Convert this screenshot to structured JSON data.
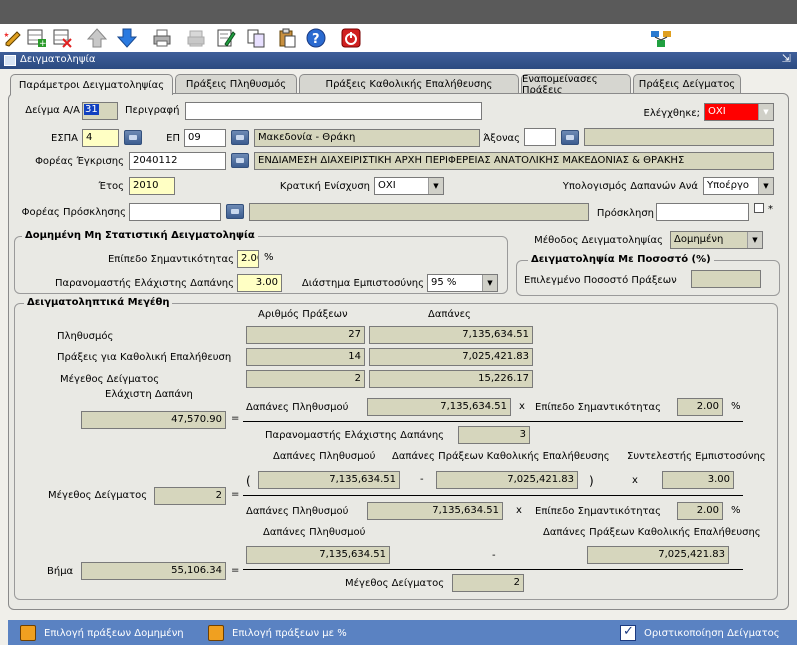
{
  "window": {
    "title": "Δειγματοληψία"
  },
  "toolbar": {
    "icons": [
      "pencil-star-icon",
      "add-row-icon",
      "delete-row-icon",
      "arrow-up-icon",
      "arrow-down-icon",
      "print-icon",
      "print-disabled-icon",
      "edit-doc-icon",
      "copy-icon",
      "paste-icon",
      "help-icon",
      "exit-icon",
      "hierarchy-icon"
    ]
  },
  "tabs": [
    "Παράμετροι Δειγματοληψίας",
    "Πράξεις Πληθυσμός",
    "Πράξεις Καθολικής Επαλήθευσης",
    "Εναπομείνασες Πράξεις",
    "Πράξεις Δείγματος"
  ],
  "form": {
    "sample_label": "Δείγμα Α/Α",
    "sample_value": "31",
    "description_label": "Περιγραφή",
    "description_value": "",
    "checked_label": "Ελέγχθηκε;",
    "checked_value": "ΟΧΙ",
    "espa_label": "ΕΣΠΑ",
    "espa_value": "4",
    "ep_label": "ΕΠ",
    "ep_value": "09",
    "ep_name": "Μακεδονία - Θράκη",
    "axis_label": "Άξονας",
    "axis_value": "",
    "axis_name": "",
    "approval_label": "Φορέας Έγκρισης",
    "approval_value": "2040112",
    "approval_name": "ΕΝΔΙΑΜΕΣΗ ΔΙΑΧΕΙΡΙΣΤΙΚΗ ΑΡΧΗ ΠΕΡΙΦΕΡΕΙΑΣ ΑΝΑΤΟΛΙΚΗΣ ΜΑΚΕΔΟΝΙΑΣ & ΘΡΑΚΗΣ",
    "year_label": "Έτος",
    "year_value": "2010",
    "state_aid_label": "Κρατική Ενίσχυση",
    "state_aid_value": "ΟΧΙ",
    "calc_label": "Υπολογισμός Δαπανών Ανά",
    "calc_value": "Υποέργο",
    "invitation_body_label": "Φορέας Πρόσκλησης",
    "invitation_body_value": "",
    "invitation_body_name": "",
    "invitation_label": "Πρόσκληση",
    "invitation_value": "",
    "star": "*",
    "method_label": "Μέθοδος Δειγματοληψίας",
    "method_value": "Δομημένη"
  },
  "structured": {
    "title": "Δομημένη Μη Στατιστική Δειγματοληψία",
    "significance_label": "Επίπεδο Σημαντικότητας",
    "significance_value": "2.00",
    "percent": "%",
    "min_expense_label": "Παρανομαστής Ελάχιστης Δαπάνης",
    "min_expense_value": "3.00",
    "confidence_label": "Διάστημα Εμπιστοσύνης",
    "confidence_value": "95 %"
  },
  "percentage": {
    "title": "Δειγματοληψία Με Ποσοστό (%)",
    "selected_label": "Επιλεγμένο Ποσοστό Πράξεων",
    "selected_value": ""
  },
  "sizes": {
    "title": "Δειγματοληπτικά Μεγέθη",
    "col_count": "Αριθμός Πράξεων",
    "col_expenses": "Δαπάνες",
    "rows": [
      {
        "label": "Πληθυσμός",
        "count": "27",
        "expenses": "7,135,634.51"
      },
      {
        "label": "Πράξεις για Καθολική Επαλήθευση",
        "count": "14",
        "expenses": "7,025,421.83"
      },
      {
        "label": "Μέγεθος Δείγματος",
        "count": "2",
        "expenses": "15,226.17"
      }
    ],
    "min_expense_title": "Ελάχιστη Δαπάνη",
    "min_expense_value": "47,570.90",
    "eq": "=",
    "pop_expenses_label": "Δαπάνες Πληθυσμού",
    "pop_expenses_value": "7,135,634.51",
    "times": "x",
    "significance_label": "Επίπεδο Σημαντικότητας",
    "significance_value": "2.00",
    "percent": "%",
    "denominator_label": "Παρανομαστής Ελάχιστης Δαπάνης",
    "denominator_value": "3",
    "f2_header_pop": "Δαπάνες Πληθυσμού",
    "f2_header_univ": "Δαπάνες Πράξεων Καθολικής Επαλήθευσης",
    "f2_header_conf": "Συντελεστής Εμπιστοσύνης",
    "sample_size_label": "Μέγεθος Δείγματος",
    "sample_size_value": "2",
    "open_paren": "(",
    "close_paren": ")",
    "minus": "-",
    "f2_pop_value": "7,135,634.51",
    "f2_univ_value": "7,025,421.83",
    "f2_conf_value": "3.00",
    "f2_den_pop_label": "Δαπάνες Πληθυσμού",
    "f2_den_pop_value": "7,135,634.51",
    "f2_den_sig_label": "Επίπεδο Σημαντικότητας",
    "f2_den_sig_value": "2.00",
    "step_label": "Βήμα",
    "step_value": "55,106.34",
    "f3_pop_label": "Δαπάνες Πληθυσμού",
    "f3_pop_value": "7,135,634.51",
    "f3_univ_label": "Δαπάνες Πράξεων Καθολικής Επαλήθευσης",
    "f3_univ_value": "7,025,421.83",
    "f3_den_label": "Μέγεθος Δείγματος",
    "f3_den_value": "2"
  },
  "bottom": {
    "structured_btn": "Επιλογή πράξεων Δομημένη",
    "percent_btn": "Επιλογή πράξεων με %",
    "finalize_btn": "Οριστικοποίηση Δείγματος"
  },
  "colors": {
    "title_bar": "#2b4a80",
    "readonly": "#d6d6bd",
    "required": "#ffffc4",
    "alert": "#ff0000",
    "bottom_bar": "#5a82c2"
  }
}
